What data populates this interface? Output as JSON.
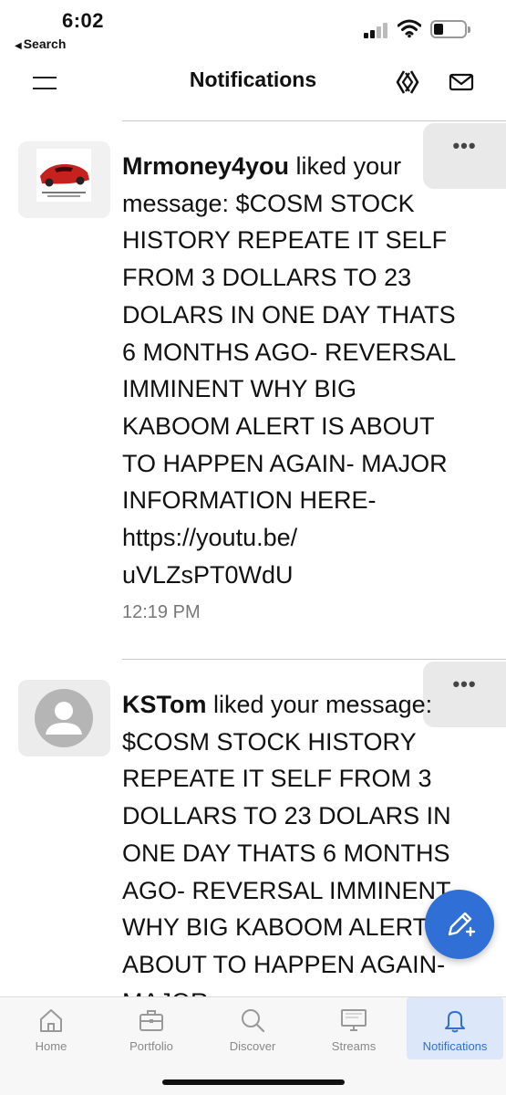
{
  "status_bar": {
    "time": "6:02",
    "back_label": "Search",
    "back_glyph": "◀"
  },
  "header": {
    "title": "Notifications",
    "left_icon": "menu-icon",
    "right_icons": [
      "logo-icon",
      "mail-icon"
    ]
  },
  "notifications": [
    {
      "user": "Mrmoney4you",
      "action": " liked your message: $COSM STOCK HISTORY REPEATE IT SELF FROM 3 DOLLARS TO 23 DOLARS IN ONE DAY THATS 6 MONTHS AGO- REVERSAL IMMINENT WHY BIG KABOOM ALERT IS ABOUT TO HAPPEN AGAIN- MAJOR INFORMATION HERE- https://youtu.be/ uVLZsPT0WdU",
      "time": "12:19 PM",
      "avatar": "red-car-image"
    },
    {
      "user": "KSTom",
      "action": " liked your message: $COSM STOCK HISTORY REPEATE IT SELF FROM 3 DOLLARS TO 23 DOLARS IN ONE DAY THATS 6 MONTHS AGO- REVERSAL IMMINENT WHY BIG KABOOM ALERT IS ABOUT TO HAPPEN AGAIN- MAJOR",
      "avatar": "default-person-icon"
    }
  ],
  "more_glyph": "•••",
  "fab_icon": "compose-icon",
  "tabs": [
    {
      "label": "Home",
      "icon": "home-icon",
      "active": false
    },
    {
      "label": "Portfolio",
      "icon": "briefcase-icon",
      "active": false
    },
    {
      "label": "Discover",
      "icon": "search-icon",
      "active": false
    },
    {
      "label": "Streams",
      "icon": "monitor-icon",
      "active": false
    },
    {
      "label": "Notifications",
      "icon": "bell-icon",
      "active": true
    }
  ],
  "colors": {
    "accent": "#2f6fd6",
    "active_tab_bg": "#dce8fa",
    "secondary_text": "#777777"
  }
}
